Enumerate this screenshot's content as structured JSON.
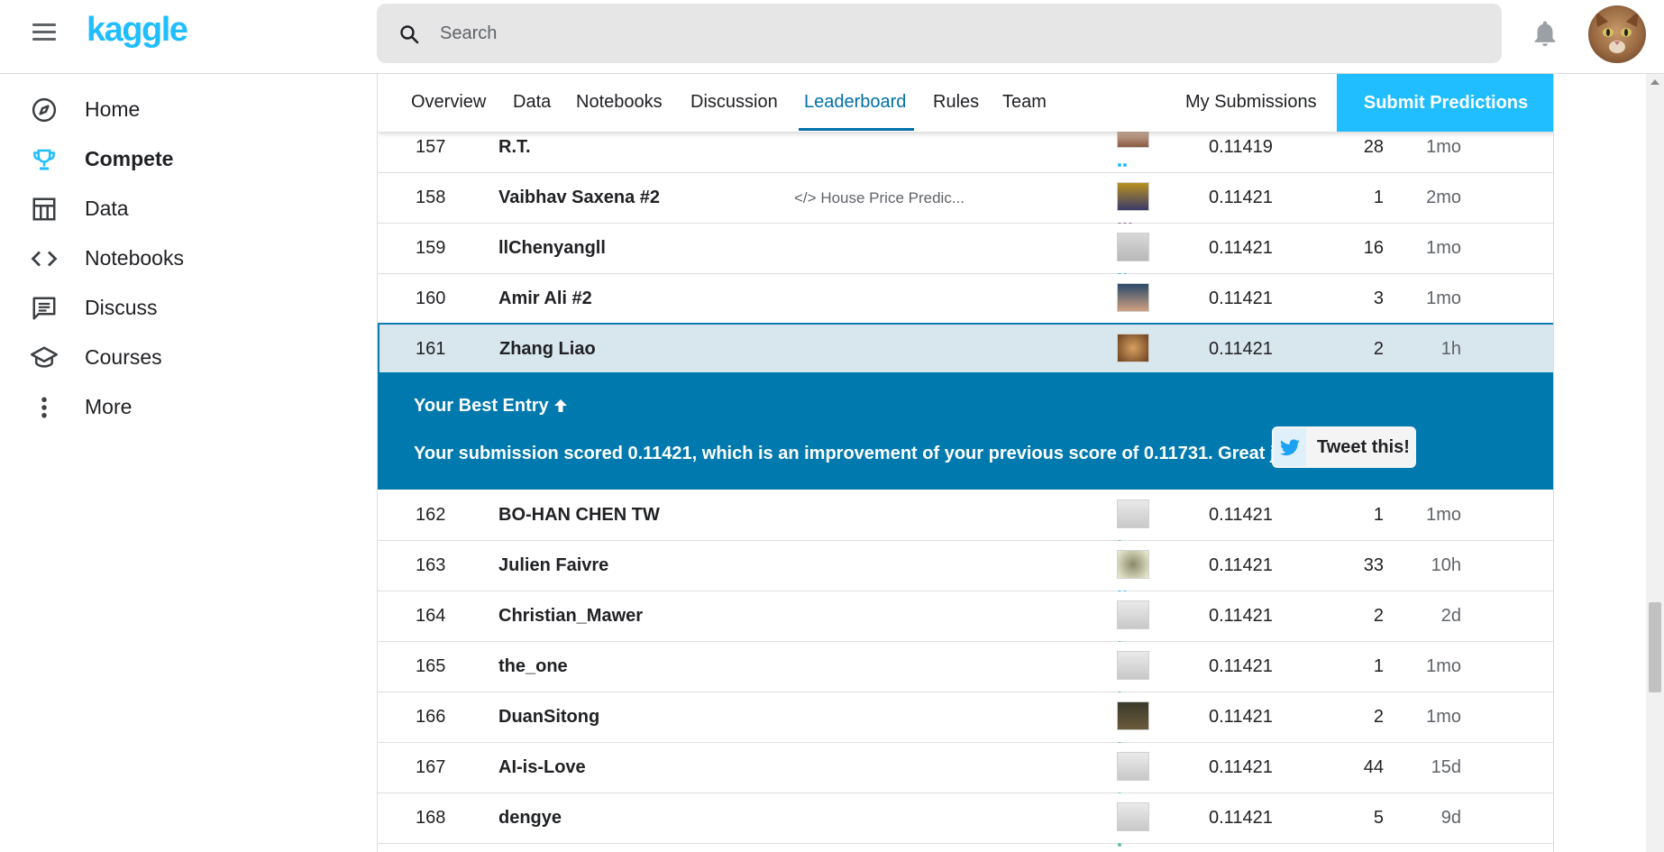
{
  "header": {
    "logo": "kaggle",
    "search_placeholder": "Search"
  },
  "sidebar": {
    "items": [
      {
        "label": "Home",
        "icon": "compass-icon"
      },
      {
        "label": "Compete",
        "icon": "trophy-icon",
        "active": true
      },
      {
        "label": "Data",
        "icon": "table-icon"
      },
      {
        "label": "Notebooks",
        "icon": "code-icon"
      },
      {
        "label": "Discuss",
        "icon": "comment-icon"
      },
      {
        "label": "Courses",
        "icon": "school-icon"
      },
      {
        "label": "More",
        "icon": "more-vert-icon"
      }
    ]
  },
  "tabs": {
    "items": [
      "Overview",
      "Data",
      "Notebooks",
      "Discussion",
      "Leaderboard",
      "Rules",
      "Team"
    ],
    "active": "Leaderboard",
    "my_submissions": "My Submissions",
    "submit": "Submit Predictions"
  },
  "leaderboard": {
    "rows": [
      {
        "rank": "157",
        "team": "R.T.",
        "kernel": "",
        "score": "0.11419",
        "entries": "28",
        "last": "1mo"
      },
      {
        "rank": "158",
        "team": "Vaibhav Saxena #2",
        "kernel": "House Price Predic...",
        "score": "0.11421",
        "entries": "1",
        "last": "2mo"
      },
      {
        "rank": "159",
        "team": "llChenyangll",
        "kernel": "",
        "score": "0.11421",
        "entries": "16",
        "last": "1mo"
      },
      {
        "rank": "160",
        "team": "Amir Ali #2",
        "kernel": "",
        "score": "0.11421",
        "entries": "3",
        "last": "1mo"
      },
      {
        "rank": "161",
        "team": "Zhang Liao",
        "kernel": "",
        "score": "0.11421",
        "entries": "2",
        "last": "1h"
      },
      {
        "rank": "162",
        "team": "BO-HAN CHEN TW",
        "kernel": "",
        "score": "0.11421",
        "entries": "1",
        "last": "1mo"
      },
      {
        "rank": "163",
        "team": "Julien Faivre",
        "kernel": "",
        "score": "0.11421",
        "entries": "33",
        "last": "10h"
      },
      {
        "rank": "164",
        "team": "Christian_Mawer",
        "kernel": "",
        "score": "0.11421",
        "entries": "2",
        "last": "2d"
      },
      {
        "rank": "165",
        "team": "the_one",
        "kernel": "",
        "score": "0.11421",
        "entries": "1",
        "last": "1mo"
      },
      {
        "rank": "166",
        "team": "DuanSitong",
        "kernel": "",
        "score": "0.11421",
        "entries": "2",
        "last": "1mo"
      },
      {
        "rank": "167",
        "team": "AI-is-Love",
        "kernel": "",
        "score": "0.11421",
        "entries": "44",
        "last": "15d"
      },
      {
        "rank": "168",
        "team": "dengye",
        "kernel": "",
        "score": "0.11421",
        "entries": "5",
        "last": "9d"
      }
    ]
  },
  "best_entry": {
    "title": "Your Best Entry",
    "message": "Your submission scored 0.11421, which is an improvement of your previous score of 0.11731. Great job!",
    "tweet_label": "Tweet this!"
  },
  "colors": {
    "brand": "#20beff",
    "active_tab": "#0070a8",
    "banner": "#0079ae",
    "highlight_row": "#d8e6ee",
    "tier_contributor": "#20beff",
    "tier_novice": "#5ac995",
    "tier_expert": "#95588a"
  }
}
